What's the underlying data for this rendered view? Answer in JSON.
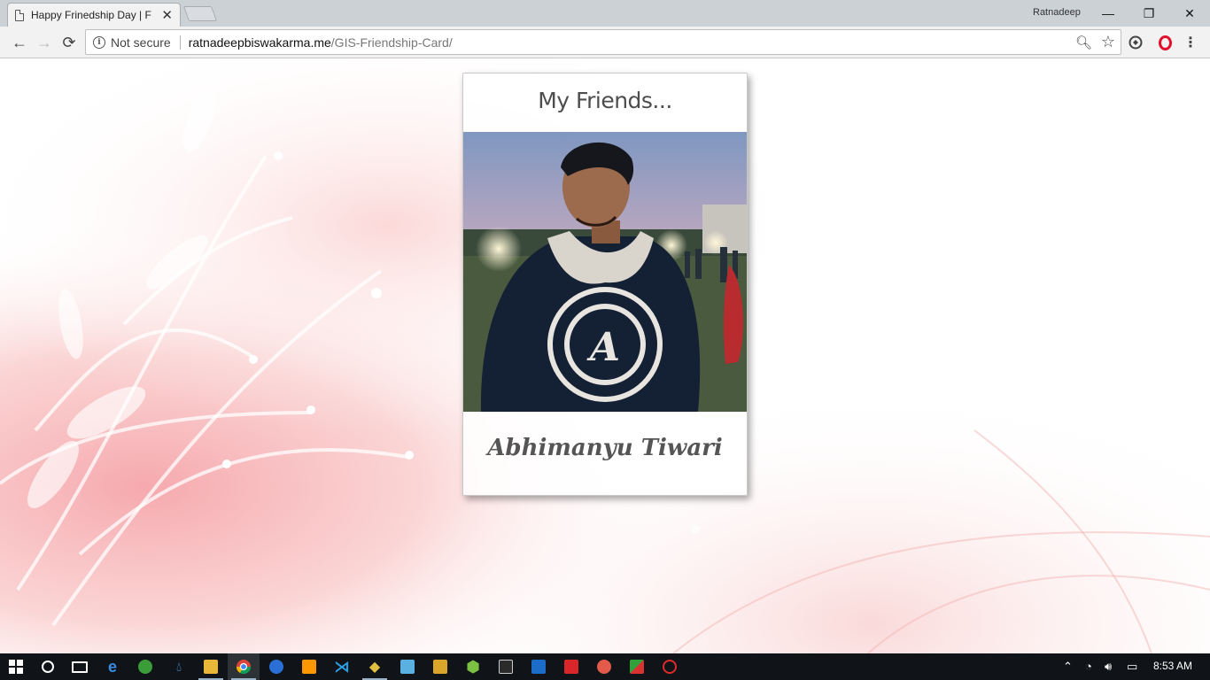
{
  "browser": {
    "tab_title": "Happy Frinedship Day | F",
    "profile_name": "Ratnadeep",
    "security_label": "Not secure",
    "url_host": "ratnadeepbiswakarma.me",
    "url_path": "/GIS-Friendship-Card/",
    "window_buttons": {
      "minimize": "—",
      "maximize": "❐",
      "close": "✕"
    },
    "tab_close": "✕",
    "nav": {
      "back": "←",
      "forward": "→",
      "reload": "⟳"
    },
    "omnibox_icons": {
      "zoom": "🔍︎",
      "star": "☆"
    },
    "menu": "⋮"
  },
  "card": {
    "heading": "My Friends...",
    "friend_name": "Abhimanyu Tiwari",
    "photo_description_icon": "friend-photo"
  },
  "taskbar": {
    "apps": [
      "start-icon",
      "cortana-icon",
      "task-view-icon",
      "edge-icon",
      "app-green-icon",
      "drop-icon",
      "file-explorer-icon",
      "chrome-icon",
      "firefox-icon",
      "sublime-icon",
      "vscode-icon",
      "git-icon",
      "app-monitor-icon",
      "app-folder-icon",
      "app-hex-icon",
      "terminal-icon",
      "app-blue-icon",
      "acrobat-icon",
      "app-paint-icon",
      "app-cross-icon",
      "app-red-icon"
    ],
    "clock": "8:53 AM"
  },
  "colors": {
    "heading": "#4d4d4d",
    "name": "#555555",
    "opera_red": "#e0112b"
  }
}
